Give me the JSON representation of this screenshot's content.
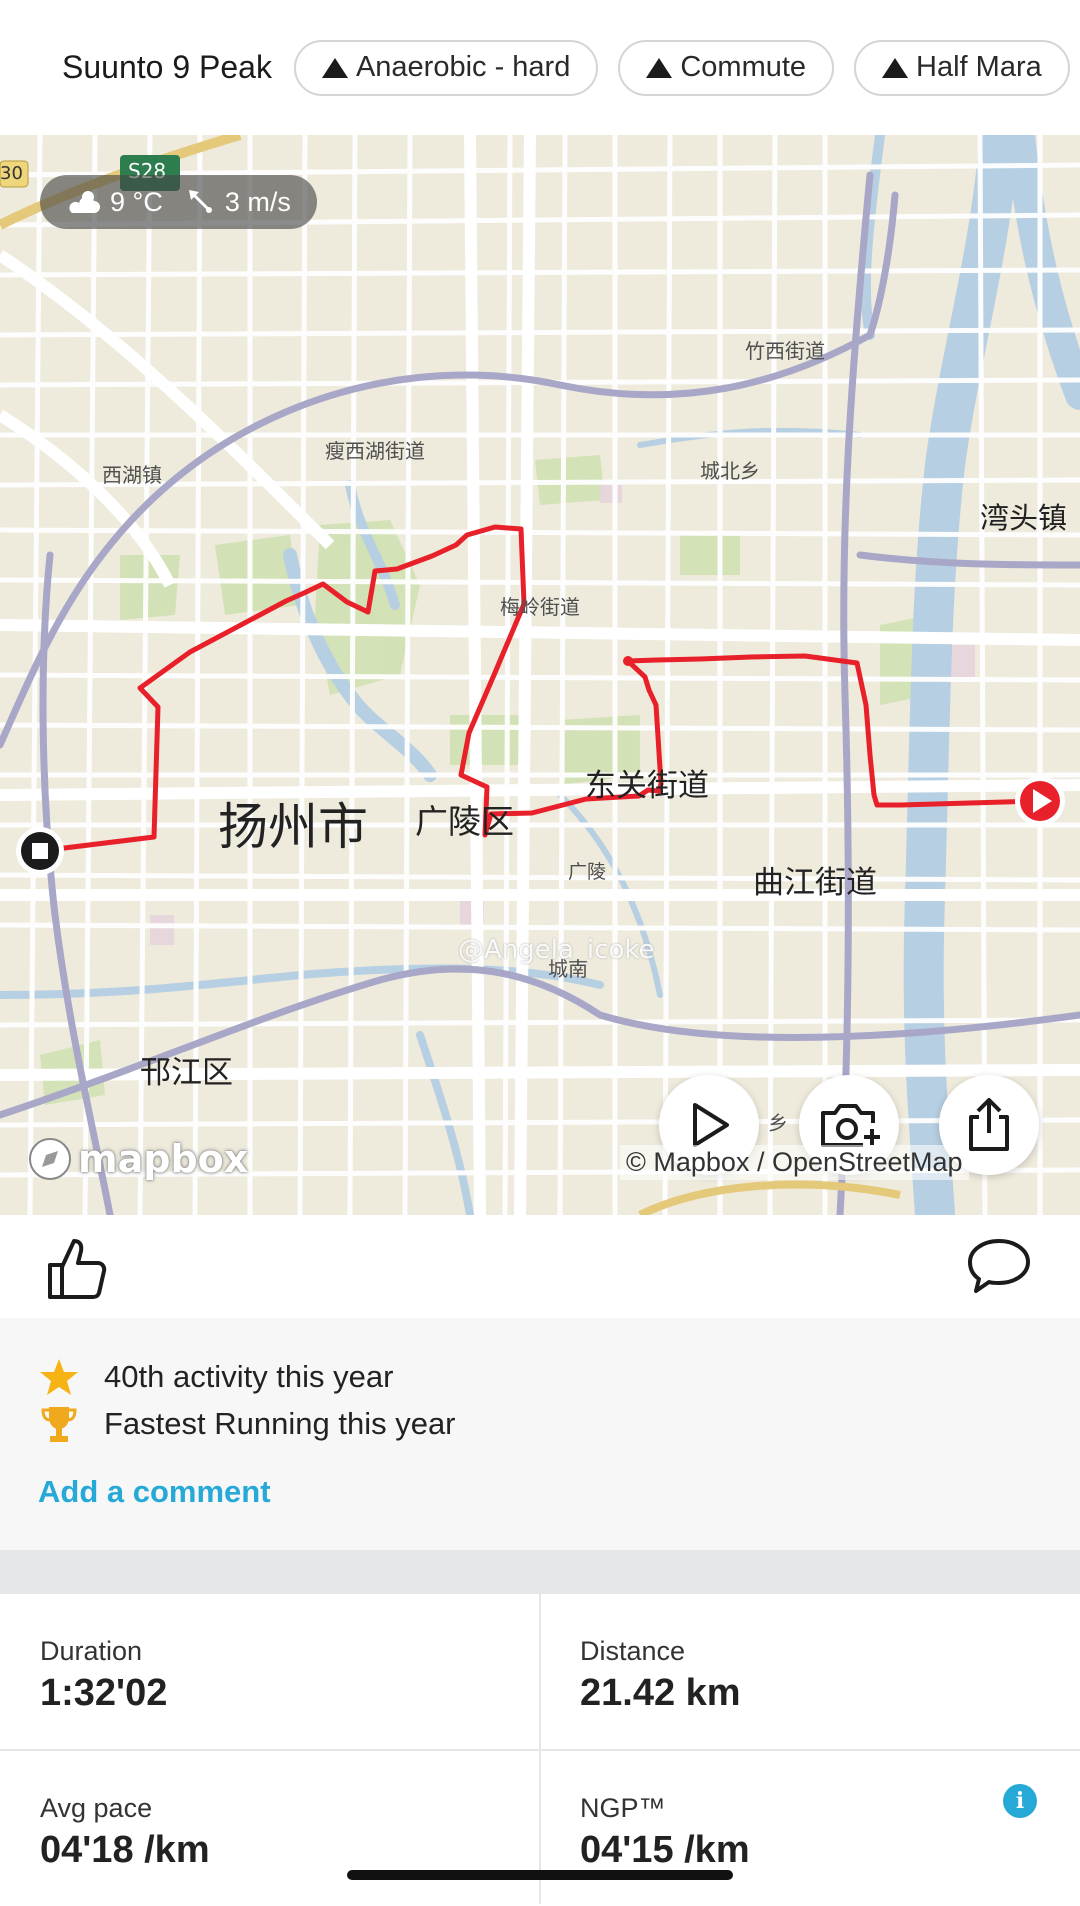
{
  "header": {
    "device_name": "Suunto 9 Peak",
    "tags": [
      {
        "label": "Anaerobic - hard",
        "icon": "triangle-icon"
      },
      {
        "label": "Commute",
        "icon": "triangle-icon"
      },
      {
        "label": "Half Mara",
        "icon": "triangle-icon"
      }
    ]
  },
  "map": {
    "weather": {
      "temperature": "9 °C",
      "wind": "3 m/s"
    },
    "road_shield": "S28",
    "edge_shield": "30",
    "labels": {
      "zhuxi": "竹西街道",
      "shouxihu": "瘦西湖街道",
      "xihu": "西湖镇",
      "chengbei": "城北乡",
      "wantou": "湾头镇",
      "meiling": "梅岭街道",
      "dongguan": "东关街道",
      "yangzhou": "扬州市",
      "guangling_district": "广陵区",
      "guangling": "广陵",
      "qujiang": "曲江街道",
      "watermark": "@Angela_icoke",
      "chengnan": "城南",
      "hanjiang": "邗江区",
      "xiang": "乡"
    },
    "mapbox_logo": "mapbox",
    "attribution": "© Mapbox / OpenStreetMap",
    "route_color": "#e8202a"
  },
  "social": {
    "like_icon": "thumbs-up-icon",
    "comment_icon": "comment-icon"
  },
  "achievements": {
    "items": [
      {
        "icon": "star-icon",
        "text": "40th activity this year"
      },
      {
        "icon": "trophy-icon",
        "text": "Fastest Running this year"
      }
    ],
    "add_comment": "Add a comment"
  },
  "stats": [
    {
      "label": "Duration",
      "value": "1:32'02"
    },
    {
      "label": "Distance",
      "value": "21.42 km"
    },
    {
      "label": "Avg pace",
      "value": "04'18 /km"
    },
    {
      "label": "NGP™",
      "value": "04'15 /km"
    }
  ],
  "colors": {
    "accent": "#27a9d8",
    "star": "#f5b316",
    "trophy": "#f0a81c"
  }
}
